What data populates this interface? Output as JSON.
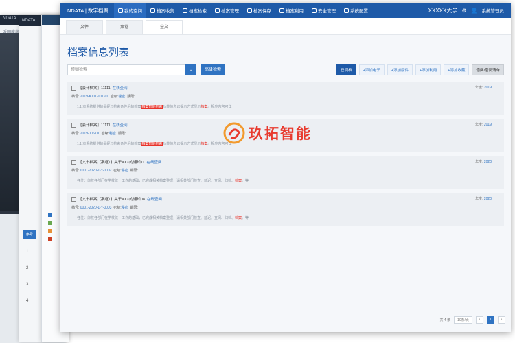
{
  "background": {
    "win1_title": "NDATA",
    "win1_sub": "返回库房",
    "win2_title": "NDATA",
    "win2_sub": "档",
    "table_header": "序号",
    "row_numbers": [
      "1",
      "2",
      "3",
      "4"
    ]
  },
  "header": {
    "logo": "NDATA | 数字档案",
    "nav": [
      {
        "label": "我的空间"
      },
      {
        "label": "档案收集"
      },
      {
        "label": "档案检索"
      },
      {
        "label": "档案管理"
      },
      {
        "label": "档案保存"
      },
      {
        "label": "档案利用"
      },
      {
        "label": "安全管理"
      },
      {
        "label": "系统配置"
      }
    ],
    "org": "XXXXX大学",
    "user": "系统管理员"
  },
  "tabs": [
    "文件",
    "案卷",
    "全文"
  ],
  "title": "档案信息列表",
  "search": {
    "placeholder": "模糊检索",
    "advanced_label": "高级检索"
  },
  "actions": [
    "已调档",
    "+添加电子",
    "+添加原件",
    "+添加利用",
    "+添加收藏",
    "借阅/借阅清单"
  ],
  "records": [
    {
      "title": "【会计档案】11111",
      "link": "在线查阅",
      "code": "2019-KJ01-001-01",
      "secret_label": "密级:",
      "secret": "秘密",
      "period_label": "期限:",
      "period": "",
      "snippet_pre": "1.1 本系统提供的是经过检索条件后的档案",
      "snippet_hl": "档案智能检索",
      "snippet_mid": "功能信息以提示方式显示",
      "snippet_kw": "档案",
      "snippet_post": "。相应内容可详",
      "year_label": "年度:",
      "year": "2019"
    },
    {
      "title": "【会计档案】11111",
      "link": "在线查阅",
      "code": "2019-J06-01",
      "secret_label": "密级:",
      "secret": "秘密",
      "period_label": "期限:",
      "period": "",
      "snippet_pre": "1.1 本系统提供的是经过检索条件后的档案",
      "snippet_hl": "档案智能检索",
      "snippet_mid": "功能信息以提示方式显示",
      "snippet_kw": "档案",
      "snippet_post": "。相应内容可详",
      "year_label": "年度:",
      "year": "2019"
    },
    {
      "title": "【文书档案（案卷）】关于XXX的通知11",
      "link": "在线查阅",
      "code": "0001-2020-1-Y-0002",
      "secret_label": "密级:",
      "secret": "秘密",
      "period_label": "期限:",
      "period": "",
      "snippet_pre": "各位：你校各部门在学校统一工作的基础，已完成相关档案整理，请相关部门核查、",
      "snippet_hl": "",
      "snippet_mid": "延迟、查阅、归档、",
      "snippet_kw": "档案",
      "snippet_post": "。等",
      "year_label": "年度:",
      "year": "2020"
    },
    {
      "title": "【文书档案（案卷）】关于XXX的通知08",
      "link": "在线查阅",
      "code": "0001-2020-1-Y-0003",
      "secret_label": "密级:",
      "secret": "秘密",
      "period_label": "期限:",
      "period": "",
      "snippet_pre": "各位：你校各部门在学校统一工作的基础，已完成相关档案整理，请相关部门核查、",
      "snippet_hl": "",
      "snippet_mid": "延迟、查阅、归档、",
      "snippet_kw": "档案",
      "snippet_post": "。等",
      "year_label": "年度:",
      "year": "2020"
    }
  ],
  "pager": {
    "total": "共 4 条",
    "size": "10条/页",
    "current": "1"
  },
  "watermark": {
    "text": "玖拓智能"
  }
}
